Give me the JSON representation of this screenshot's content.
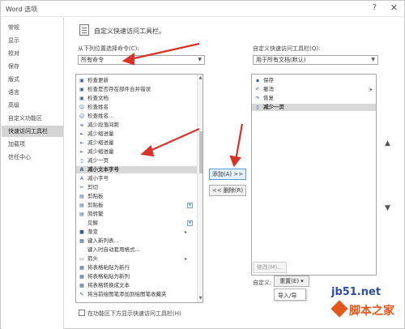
{
  "window": {
    "title": "Word 选项",
    "help_glyph": "?",
    "close_glyph": "✕"
  },
  "nav": {
    "items": [
      {
        "label": "常规"
      },
      {
        "label": "显示"
      },
      {
        "label": "校对"
      },
      {
        "label": "保存"
      },
      {
        "label": "版式"
      },
      {
        "label": "语言"
      },
      {
        "label": "高级"
      },
      {
        "label": "自定义功能区"
      },
      {
        "label": "快速访问工具栏",
        "active": true
      },
      {
        "label": "加载项"
      },
      {
        "label": "信任中心"
      }
    ]
  },
  "header": {
    "text": "自定义快速访问工具栏。"
  },
  "left": {
    "choose_label": "从下列位置选择命令(C):",
    "choose_value": "所有命令",
    "commands": [
      {
        "icon": "doc-icon",
        "glyph": "▣",
        "label": "检查更新"
      },
      {
        "icon": "doc-icon",
        "glyph": "▣",
        "label": "检查是否存在部件合并错误"
      },
      {
        "icon": "doc-icon",
        "glyph": "▣",
        "label": "检查文档"
      },
      {
        "icon": "people-icon",
        "glyph": "☺",
        "label": "检查姓名"
      },
      {
        "icon": "people-icon",
        "glyph": "☺",
        "label": "检查姓名..."
      },
      {
        "icon": "spacing-icon",
        "glyph": "≡",
        "label": "减少段落间距"
      },
      {
        "icon": "indent-icon",
        "glyph": "⇤",
        "label": "减少缩进量"
      },
      {
        "icon": "indent-icon",
        "glyph": "⇤",
        "label": "减少缩进量"
      },
      {
        "icon": "indent-icon",
        "glyph": "⇤",
        "label": "减少缩进量"
      },
      {
        "icon": "page-icon",
        "glyph": "▯",
        "label": "减少一页"
      },
      {
        "icon": "font-size-icon",
        "glyph": "A",
        "label": "减小文本字号",
        "selected": true
      },
      {
        "icon": "font-size-icon",
        "glyph": "A",
        "label": "减小字号"
      },
      {
        "icon": "scissors-icon",
        "glyph": "✂",
        "label": "剪切"
      },
      {
        "icon": "clipboard-icon",
        "glyph": "▤",
        "label": "剪贴板"
      },
      {
        "icon": "clipboard-icon",
        "glyph": "▤",
        "label": "剪贴板",
        "mini": true
      },
      {
        "icon": "clipboard-icon",
        "glyph": "▤",
        "label": "简转繁"
      },
      {
        "icon": "none",
        "glyph": "",
        "label": "见解",
        "mini": true
      },
      {
        "icon": "gradient-icon",
        "glyph": "■",
        "label": "渐变",
        "sub": "▸"
      },
      {
        "icon": "table-icon",
        "glyph": "▦",
        "label": "键入新列表..."
      },
      {
        "icon": "none",
        "glyph": "",
        "label": "键入时自动套用格式..."
      },
      {
        "icon": "box-icon",
        "glyph": "▭",
        "label": "箭头",
        "sub": "▸"
      },
      {
        "icon": "table-icon",
        "glyph": "▦",
        "label": "将表格粘贴为新行"
      },
      {
        "icon": "table-icon",
        "glyph": "▦",
        "label": "将表格粘贴为新列"
      },
      {
        "icon": "table-icon",
        "glyph": "▦",
        "label": "将表格转换成文本"
      },
      {
        "icon": "pen-icon",
        "glyph": "✎",
        "label": "将当前绘图笔添加到绘图笔收藏夹"
      }
    ],
    "checkbox_label": "在功能区下方显示快速访问工具栏(H)"
  },
  "buttons": {
    "add": "添加(A) >>",
    "remove": "<< 删除(R)"
  },
  "right": {
    "customize_label": "自定义快速访问工具栏(Q):",
    "customize_value": "用于所有文档(默认)",
    "items": [
      {
        "icon": "save-icon",
        "glyph": "▪",
        "label": "保存"
      },
      {
        "icon": "undo-icon",
        "glyph": "↶",
        "label": "撤消",
        "sub": "|▸"
      },
      {
        "icon": "redo-icon",
        "glyph": "↷",
        "label": "恢复"
      },
      {
        "icon": "page-icon",
        "glyph": "▯",
        "label": "减少一页",
        "selected": true
      }
    ],
    "modify": "修改(M)...",
    "custom_label": "自定义:",
    "reset": "重置(E) ▾",
    "import_export": "导入/导"
  },
  "watermark": {
    "url": "jb51.net",
    "text": "脚本之家"
  },
  "colors": {
    "selected_row": "#d8d8d8",
    "active_nav": "#d4d4d4",
    "arrow_red": "#d8322a",
    "watermark_orange": "#e4571c",
    "watermark_blue": "#2a4ea2"
  }
}
